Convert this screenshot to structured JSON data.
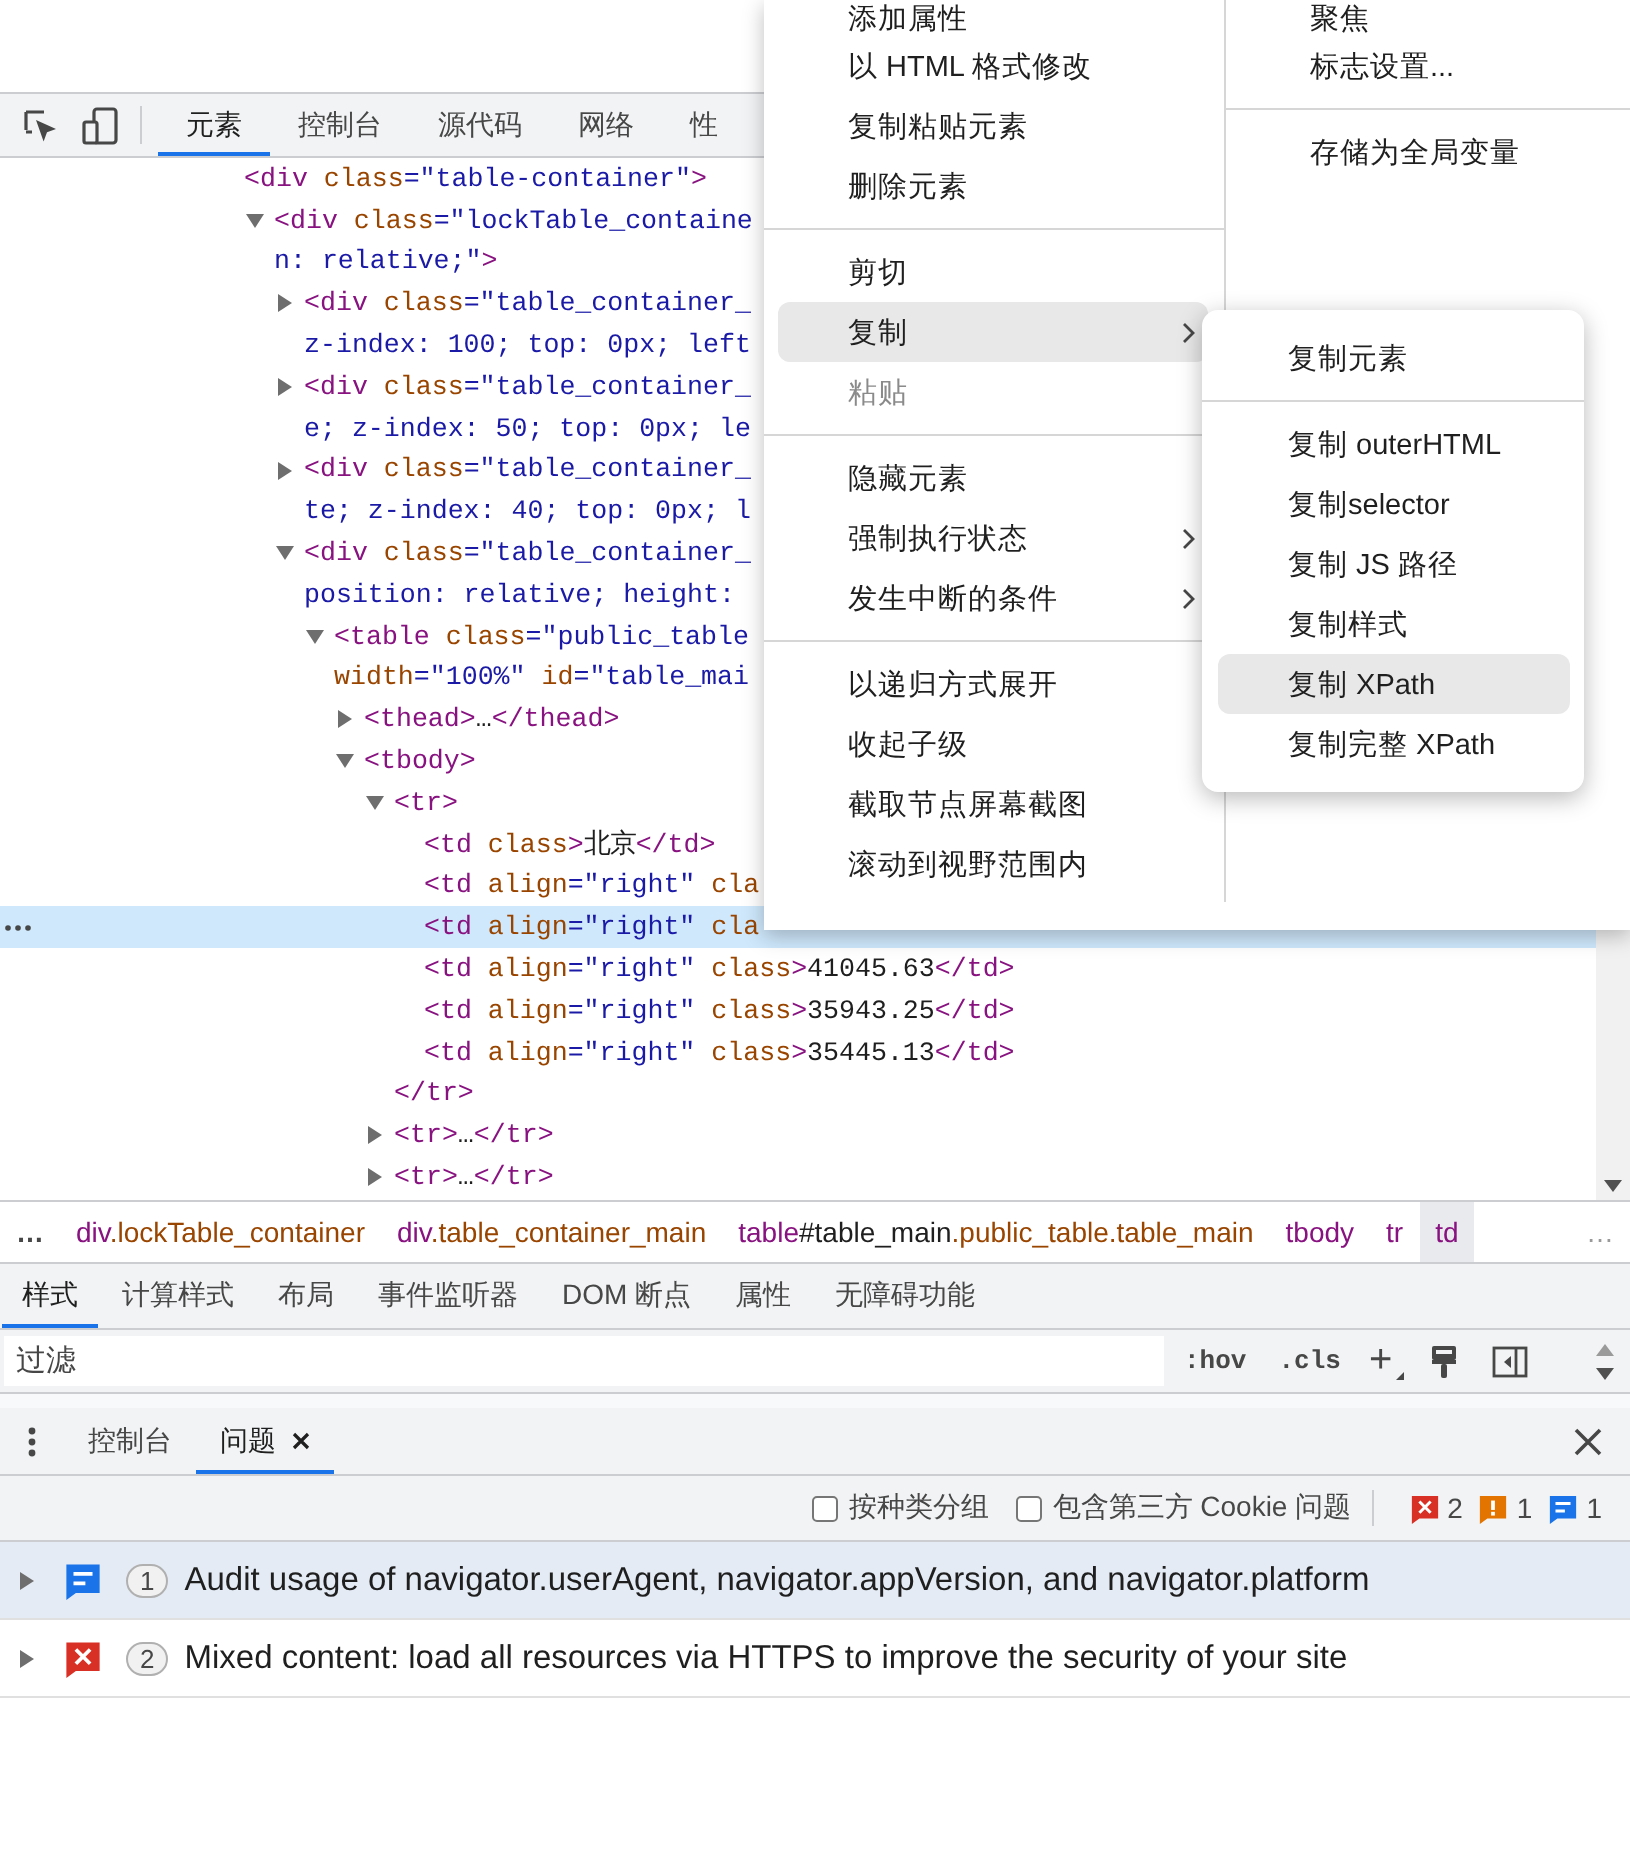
{
  "toolbar": {
    "tabs": [
      {
        "label": "元素",
        "selected": true
      },
      {
        "label": "控制台",
        "selected": false
      },
      {
        "label": "源代码",
        "selected": false
      },
      {
        "label": "网络",
        "selected": false
      },
      {
        "label": "性",
        "selected": false
      }
    ]
  },
  "dom_tree": {
    "nodes": [
      {
        "lines": [
          [
            {
              "kind": "tag",
              "text": "<div "
            },
            {
              "kind": "attr",
              "text": "class"
            },
            {
              "kind": "value",
              "text": "=\"table-container\""
            },
            {
              "kind": "tag",
              "text": ">"
            }
          ]
        ],
        "selected": false,
        "children": [
          {
            "lines": [
              [
                {
                  "kind": "tag",
                  "text": "<div "
                },
                {
                  "kind": "attr",
                  "text": "class"
                },
                {
                  "kind": "value",
                  "text": "=\"lockTable_containe"
                }
              ],
              [
                {
                  "kind": "value",
                  "text": "n: relative;\""
                },
                {
                  "kind": "tag",
                  "text": ">"
                }
              ]
            ],
            "expanded": true,
            "selected": false,
            "children": [
              {
                "lines": [
                  [
                    {
                      "kind": "tag",
                      "text": "<div "
                    },
                    {
                      "kind": "attr",
                      "text": "class"
                    },
                    {
                      "kind": "value",
                      "text": "=\"table_container_"
                    }
                  ],
                  [
                    {
                      "kind": "value",
                      "text": "z-index: 100; top: 0px; left"
                    }
                  ]
                ],
                "expanded": false,
                "selected": false
              },
              {
                "lines": [
                  [
                    {
                      "kind": "tag",
                      "text": "<div "
                    },
                    {
                      "kind": "attr",
                      "text": "class"
                    },
                    {
                      "kind": "value",
                      "text": "=\"table_container_"
                    }
                  ],
                  [
                    {
                      "kind": "value",
                      "text": "e; z-index: 50; top: 0px; le"
                    }
                  ]
                ],
                "expanded": false,
                "selected": false
              },
              {
                "lines": [
                  [
                    {
                      "kind": "tag",
                      "text": "<div "
                    },
                    {
                      "kind": "attr",
                      "text": "class"
                    },
                    {
                      "kind": "value",
                      "text": "=\"table_container_"
                    }
                  ],
                  [
                    {
                      "kind": "value",
                      "text": "te; z-index: 40; top: 0px; l"
                    }
                  ]
                ],
                "expanded": false,
                "selected": false
              },
              {
                "lines": [
                  [
                    {
                      "kind": "tag",
                      "text": "<div "
                    },
                    {
                      "kind": "attr",
                      "text": "class"
                    },
                    {
                      "kind": "value",
                      "text": "=\"table_container_"
                    }
                  ],
                  [
                    {
                      "kind": "value",
                      "text": "position: relative; height:"
                    }
                  ]
                ],
                "expanded": true,
                "selected": false,
                "children": [
                  {
                    "lines": [
                      [
                        {
                          "kind": "tag",
                          "text": "<table "
                        },
                        {
                          "kind": "attr",
                          "text": "class"
                        },
                        {
                          "kind": "value",
                          "text": "=\"public_table"
                        }
                      ],
                      [
                        {
                          "kind": "attr",
                          "text": "width"
                        },
                        {
                          "kind": "value",
                          "text": "=\"100%\" "
                        },
                        {
                          "kind": "attr",
                          "text": "id"
                        },
                        {
                          "kind": "value",
                          "text": "=\"table_mai"
                        }
                      ]
                    ],
                    "expanded": true,
                    "selected": false,
                    "children": [
                      {
                        "lines": [
                          [
                            {
                              "kind": "tag",
                              "text": "<thead>"
                            },
                            {
                              "kind": "text",
                              "text": "…"
                            },
                            {
                              "kind": "tag",
                              "text": "</thead>"
                            }
                          ]
                        ],
                        "expanded": false,
                        "selected": false
                      },
                      {
                        "lines": [
                          [
                            {
                              "kind": "tag",
                              "text": "<tbody>"
                            }
                          ]
                        ],
                        "expanded": true,
                        "selected": false,
                        "children": [
                          {
                            "lines": [
                              [
                                {
                                  "kind": "tag",
                                  "text": "<tr>"
                                }
                              ]
                            ],
                            "expanded": true,
                            "selected": false,
                            "close": [
                              {
                                "kind": "tag",
                                "text": "</tr>"
                              }
                            ],
                            "children": [
                              {
                                "lines": [
                                  [
                                    {
                                      "kind": "tag",
                                      "text": "<td "
                                    },
                                    {
                                      "kind": "attr",
                                      "text": "class"
                                    },
                                    {
                                      "kind": "tag",
                                      "text": ">"
                                    },
                                    {
                                      "kind": "text",
                                      "text": "北京"
                                    },
                                    {
                                      "kind": "tag",
                                      "text": "</td>"
                                    }
                                  ]
                                ],
                                "selected": false
                              },
                              {
                                "lines": [
                                  [
                                    {
                                      "kind": "tag",
                                      "text": "<td "
                                    },
                                    {
                                      "kind": "attr",
                                      "text": "align"
                                    },
                                    {
                                      "kind": "value",
                                      "text": "=\"right\" "
                                    },
                                    {
                                      "kind": "attr",
                                      "text": "cla"
                                    }
                                  ]
                                ],
                                "selected": false
                              },
                              {
                                "lines": [
                                  [
                                    {
                                      "kind": "tag",
                                      "text": "<td "
                                    },
                                    {
                                      "kind": "attr",
                                      "text": "align"
                                    },
                                    {
                                      "kind": "value",
                                      "text": "=\"right\" "
                                    },
                                    {
                                      "kind": "attr",
                                      "text": "cla"
                                    }
                                  ]
                                ],
                                "selected": true
                              },
                              {
                                "lines": [
                                  [
                                    {
                                      "kind": "tag",
                                      "text": "<td "
                                    },
                                    {
                                      "kind": "attr",
                                      "text": "align"
                                    },
                                    {
                                      "kind": "value",
                                      "text": "=\"right\" "
                                    },
                                    {
                                      "kind": "attr",
                                      "text": "class"
                                    },
                                    {
                                      "kind": "tag",
                                      "text": ">"
                                    },
                                    {
                                      "kind": "text",
                                      "text": "41045.63"
                                    },
                                    {
                                      "kind": "tag",
                                      "text": "</td>"
                                    }
                                  ]
                                ],
                                "selected": false
                              },
                              {
                                "lines": [
                                  [
                                    {
                                      "kind": "tag",
                                      "text": "<td "
                                    },
                                    {
                                      "kind": "attr",
                                      "text": "align"
                                    },
                                    {
                                      "kind": "value",
                                      "text": "=\"right\" "
                                    },
                                    {
                                      "kind": "attr",
                                      "text": "class"
                                    },
                                    {
                                      "kind": "tag",
                                      "text": ">"
                                    },
                                    {
                                      "kind": "text",
                                      "text": "35943.25"
                                    },
                                    {
                                      "kind": "tag",
                                      "text": "</td>"
                                    }
                                  ]
                                ],
                                "selected": false
                              },
                              {
                                "lines": [
                                  [
                                    {
                                      "kind": "tag",
                                      "text": "<td "
                                    },
                                    {
                                      "kind": "attr",
                                      "text": "align"
                                    },
                                    {
                                      "kind": "value",
                                      "text": "=\"right\" "
                                    },
                                    {
                                      "kind": "attr",
                                      "text": "class"
                                    },
                                    {
                                      "kind": "tag",
                                      "text": ">"
                                    },
                                    {
                                      "kind": "text",
                                      "text": "35445.13"
                                    },
                                    {
                                      "kind": "tag",
                                      "text": "</td>"
                                    }
                                  ]
                                ],
                                "selected": false
                              }
                            ]
                          },
                          {
                            "lines": [
                              [
                                {
                                  "kind": "tag",
                                  "text": "<tr>"
                                },
                                {
                                  "kind": "text",
                                  "text": "…"
                                },
                                {
                                  "kind": "tag",
                                  "text": "</tr>"
                                }
                              ]
                            ],
                            "expanded": false,
                            "selected": false
                          },
                          {
                            "lines": [
                              [
                                {
                                  "kind": "tag",
                                  "text": "<tr>"
                                },
                                {
                                  "kind": "text",
                                  "text": "…"
                                },
                                {
                                  "kind": "tag",
                                  "text": "</tr>"
                                }
                              ]
                            ],
                            "expanded": false,
                            "selected": false
                          }
                        ]
                      }
                    ]
                  }
                ]
              }
            ]
          }
        ]
      }
    ]
  },
  "context_menu": {
    "groups": [
      [
        {
          "label": "添加属性",
          "highlighted": false,
          "disabled": false,
          "submenu": false
        },
        {
          "label": "以 HTML 格式修改",
          "highlighted": false,
          "disabled": false,
          "submenu": false
        },
        {
          "label": "复制粘贴元素",
          "highlighted": false,
          "disabled": false,
          "submenu": false
        },
        {
          "label": "删除元素",
          "highlighted": false,
          "disabled": false,
          "submenu": false
        }
      ],
      [
        {
          "label": "剪切",
          "highlighted": false,
          "disabled": false,
          "submenu": false
        },
        {
          "label": "复制",
          "highlighted": true,
          "disabled": false,
          "submenu": true
        },
        {
          "label": "粘贴",
          "highlighted": false,
          "disabled": true,
          "submenu": false
        }
      ],
      [
        {
          "label": "隐藏元素",
          "highlighted": false,
          "disabled": false,
          "submenu": false
        },
        {
          "label": "强制执行状态",
          "highlighted": false,
          "disabled": false,
          "submenu": true
        },
        {
          "label": "发生中断的条件",
          "highlighted": false,
          "disabled": false,
          "submenu": true
        }
      ],
      [
        {
          "label": "以递归方式展开",
          "highlighted": false,
          "disabled": false,
          "submenu": false
        },
        {
          "label": "收起子级",
          "highlighted": false,
          "disabled": false,
          "submenu": false
        },
        {
          "label": "截取节点屏幕截图",
          "highlighted": false,
          "disabled": false,
          "submenu": false
        },
        {
          "label": "滚动到视野范围内",
          "highlighted": false,
          "disabled": false,
          "submenu": false
        }
      ]
    ]
  },
  "side_menu": {
    "groups": [
      [
        {
          "label": "聚焦"
        },
        {
          "label": "标志设置..."
        }
      ],
      [
        {
          "label": "存储为全局变量"
        }
      ]
    ]
  },
  "copy_submenu": {
    "groups": [
      [
        {
          "label": "复制元素",
          "highlighted": false
        }
      ],
      [
        {
          "label": "复制 outerHTML",
          "highlighted": false
        },
        {
          "label": "复制selector",
          "highlighted": false
        },
        {
          "label": "复制 JS 路径",
          "highlighted": false
        },
        {
          "label": "复制样式",
          "highlighted": false
        },
        {
          "label": "复制 XPath",
          "highlighted": true
        },
        {
          "label": "复制完整 XPath",
          "highlighted": false
        }
      ]
    ]
  },
  "breadcrumbs": {
    "overflow_left": "…",
    "items": [
      {
        "segments": [
          {
            "kind": "tag",
            "text": "div"
          },
          {
            "kind": "class",
            "text": ".lockTable_container"
          }
        ],
        "selected": false
      },
      {
        "segments": [
          {
            "kind": "tag",
            "text": "div"
          },
          {
            "kind": "class",
            "text": ".table_container_main"
          }
        ],
        "selected": false
      },
      {
        "segments": [
          {
            "kind": "tag",
            "text": "table"
          },
          {
            "kind": "id",
            "text": "#table_main"
          },
          {
            "kind": "class",
            "text": ".public_table.table_main"
          }
        ],
        "selected": false
      },
      {
        "segments": [
          {
            "kind": "tag",
            "text": "tbody"
          }
        ],
        "selected": false
      },
      {
        "segments": [
          {
            "kind": "tag",
            "text": "tr"
          }
        ],
        "selected": false
      },
      {
        "segments": [
          {
            "kind": "tag",
            "text": "td"
          }
        ],
        "selected": true
      }
    ],
    "overflow_right": "…"
  },
  "styles_pane": {
    "tabs": [
      {
        "label": "样式",
        "selected": true
      },
      {
        "label": "计算样式",
        "selected": false
      },
      {
        "label": "布局",
        "selected": false
      },
      {
        "label": "事件监听器",
        "selected": false
      },
      {
        "label": "DOM 断点",
        "selected": false
      },
      {
        "label": "属性",
        "selected": false
      },
      {
        "label": "无障碍功能",
        "selected": false
      }
    ],
    "filter": {
      "placeholder": "过滤"
    },
    "buttons": [
      ":hov",
      ".cls",
      "+"
    ]
  },
  "drawer": {
    "tabs": [
      {
        "label": "控制台",
        "selected": false,
        "closable": false
      },
      {
        "label": "问题",
        "selected": true,
        "closable": true
      }
    ],
    "filters": [
      {
        "label": "按种类分组",
        "checked": false
      },
      {
        "label": "包含第三方 Cookie 问题",
        "checked": false
      }
    ],
    "counts": [
      {
        "kind": "error",
        "count": "2"
      },
      {
        "kind": "warning",
        "count": "1"
      },
      {
        "kind": "info",
        "count": "1"
      }
    ],
    "issues": [
      {
        "kind": "info",
        "count": "1",
        "text": "Audit usage of navigator.userAgent, navigator.appVersion, and navigator.platform",
        "selected": true,
        "expanded": false
      },
      {
        "kind": "error",
        "count": "2",
        "text": "Mixed content: load all resources via HTTPS to improve the security of your site",
        "selected": false,
        "expanded": false
      }
    ]
  }
}
